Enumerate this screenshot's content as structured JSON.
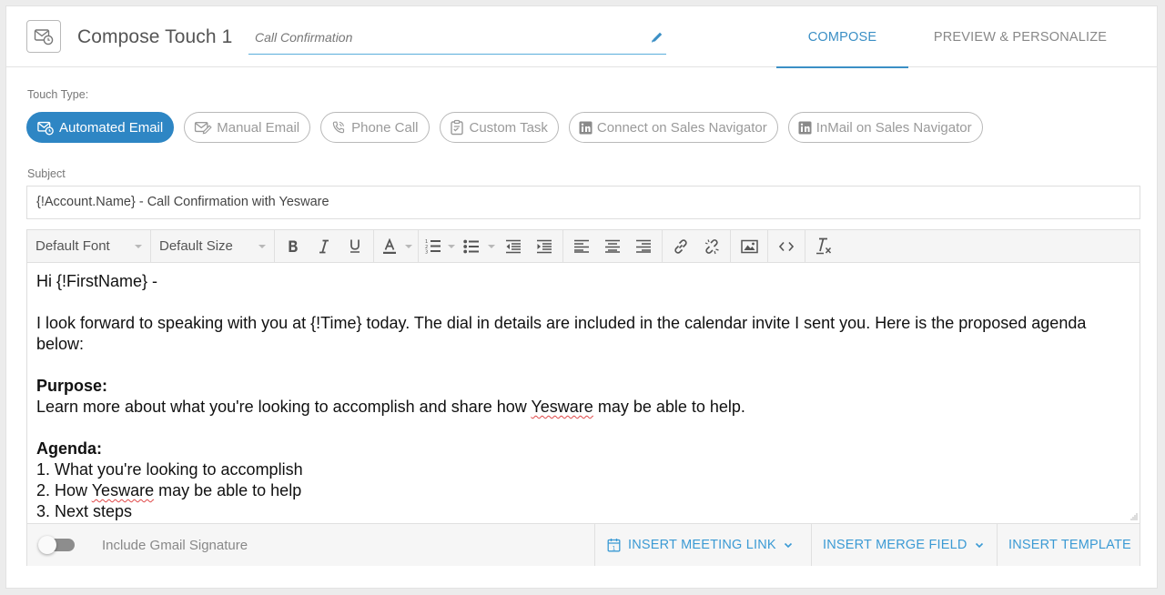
{
  "header": {
    "title": "Compose Touch 1",
    "touch_name_value": "Call Confirmation",
    "tabs": [
      {
        "label": "COMPOSE",
        "active": true
      },
      {
        "label": "PREVIEW & PERSONALIZE",
        "active": false
      }
    ]
  },
  "touch_type": {
    "label": "Touch Type:",
    "options": [
      {
        "label": "Automated Email",
        "icon": "automated-email-icon",
        "selected": true
      },
      {
        "label": "Manual Email",
        "icon": "manual-email-icon",
        "selected": false
      },
      {
        "label": "Phone Call",
        "icon": "phone-icon",
        "selected": false
      },
      {
        "label": "Custom Task",
        "icon": "clipboard-task-icon",
        "selected": false
      },
      {
        "label": "Connect on Sales Navigator",
        "icon": "linkedin-icon",
        "selected": false
      },
      {
        "label": "InMail on Sales Navigator",
        "icon": "linkedin-icon",
        "selected": false
      }
    ]
  },
  "subject": {
    "label": "Subject",
    "value": "{!Account.Name} - Call Confirmation with Yesware"
  },
  "toolbar": {
    "font_select": "Default Font",
    "size_select": "Default Size",
    "buttons": [
      "bold",
      "italic",
      "underline",
      "text-color",
      "numbered-list",
      "bulleted-list",
      "outdent",
      "indent",
      "align-left",
      "align-center",
      "align-right",
      "link",
      "unlink",
      "image",
      "source-code",
      "clear-formatting"
    ]
  },
  "body": {
    "greeting": "Hi {!FirstName} -",
    "intro": "I look forward to speaking with you at {!Time} today. The dial in details are included in the calendar invite I sent you. Here is the proposed agenda below:",
    "purpose_heading": "Purpose:",
    "purpose_text_before": "Learn more about what you're looking to accomplish and share how ",
    "purpose_text_brand": "Yesware",
    "purpose_text_after": " may be able to help.",
    "agenda_heading": "Agenda:",
    "agenda_1": "1. What you're looking to accomplish",
    "agenda_2_before": "2. How ",
    "agenda_2_brand": "Yesware",
    "agenda_2_after": " may be able to help",
    "agenda_3": "3. Next steps"
  },
  "footer": {
    "signature_label": "Include Gmail Signature",
    "signature_enabled": false,
    "insert_meeting_link": "INSERT MEETING LINK",
    "insert_merge_field": "INSERT MERGE FIELD",
    "insert_template": "INSERT TEMPLATE"
  },
  "colors": {
    "accent": "#2e86c4",
    "link": "#3b9ad4",
    "border": "#dedede"
  }
}
